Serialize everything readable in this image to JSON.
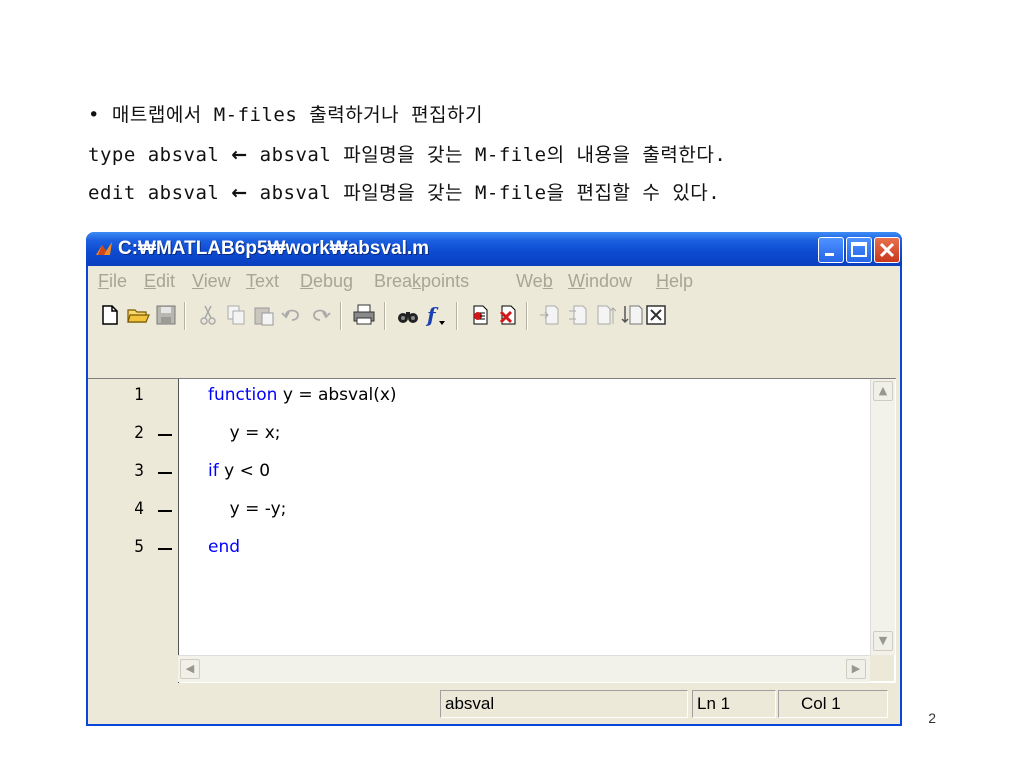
{
  "slide": {
    "line1": "• 매트랩에서 M-files 출력하거나 편집하기",
    "line2": {
      "cmd": "type absval ",
      "arrow": "←",
      "desc": " absval 파일명을 갖는 M-file의 내용을 출력한다."
    },
    "line3": {
      "cmd": "edit absval ",
      "arrow": "←",
      "desc": " absval 파일명을 갖는 M-file을 편집할 수 있다."
    },
    "page_number": "2"
  },
  "window": {
    "title": "C:₩MATLAB6p5₩work₩absval.m",
    "menu": [
      {
        "pre": "",
        "u": "F",
        "post": "ile"
      },
      {
        "pre": "",
        "u": "E",
        "post": "dit"
      },
      {
        "pre": "",
        "u": "V",
        "post": "iew"
      },
      {
        "pre": "",
        "u": "T",
        "post": "ext"
      },
      {
        "pre": "",
        "u": "D",
        "post": "ebug"
      },
      {
        "pre": "Brea",
        "u": "k",
        "post": "points"
      },
      {
        "pre": "We",
        "u": "b",
        "post": ""
      },
      {
        "pre": "",
        "u": "W",
        "post": "indow"
      },
      {
        "pre": "",
        "u": "H",
        "post": "elp"
      }
    ],
    "toolbar_icons": [
      "new-file-icon",
      "open-folder-icon",
      "save-icon",
      "cut-icon",
      "copy-icon",
      "paste-icon",
      "undo-icon",
      "redo-icon",
      "print-icon",
      "find-icon",
      "function-icon",
      "set-breakpoint-icon",
      "clear-breakpoints-icon",
      "step-icon",
      "step-in-icon",
      "step-out-icon",
      "continue-icon",
      "exit-debug-icon"
    ],
    "code_lines": [
      {
        "num": "1",
        "dash": false,
        "indent": "",
        "kw": "function",
        "rest": " y = absval(x)"
      },
      {
        "num": "2",
        "dash": true,
        "indent": "    ",
        "kw": "",
        "rest": "y = x;"
      },
      {
        "num": "3",
        "dash": true,
        "indent": "",
        "kw": "if",
        "rest": " y < 0"
      },
      {
        "num": "4",
        "dash": true,
        "indent": "    ",
        "kw": "",
        "rest": "y = -y;"
      },
      {
        "num": "5",
        "dash": true,
        "indent": "",
        "kw": "end",
        "rest": ""
      }
    ],
    "status": {
      "function_name": "absval",
      "line": "Ln 1",
      "col": "Col 1"
    },
    "colors": {
      "keyword": "#0000ff",
      "titlebar": "#0a4ad0",
      "close_button": "#c8371b"
    }
  }
}
